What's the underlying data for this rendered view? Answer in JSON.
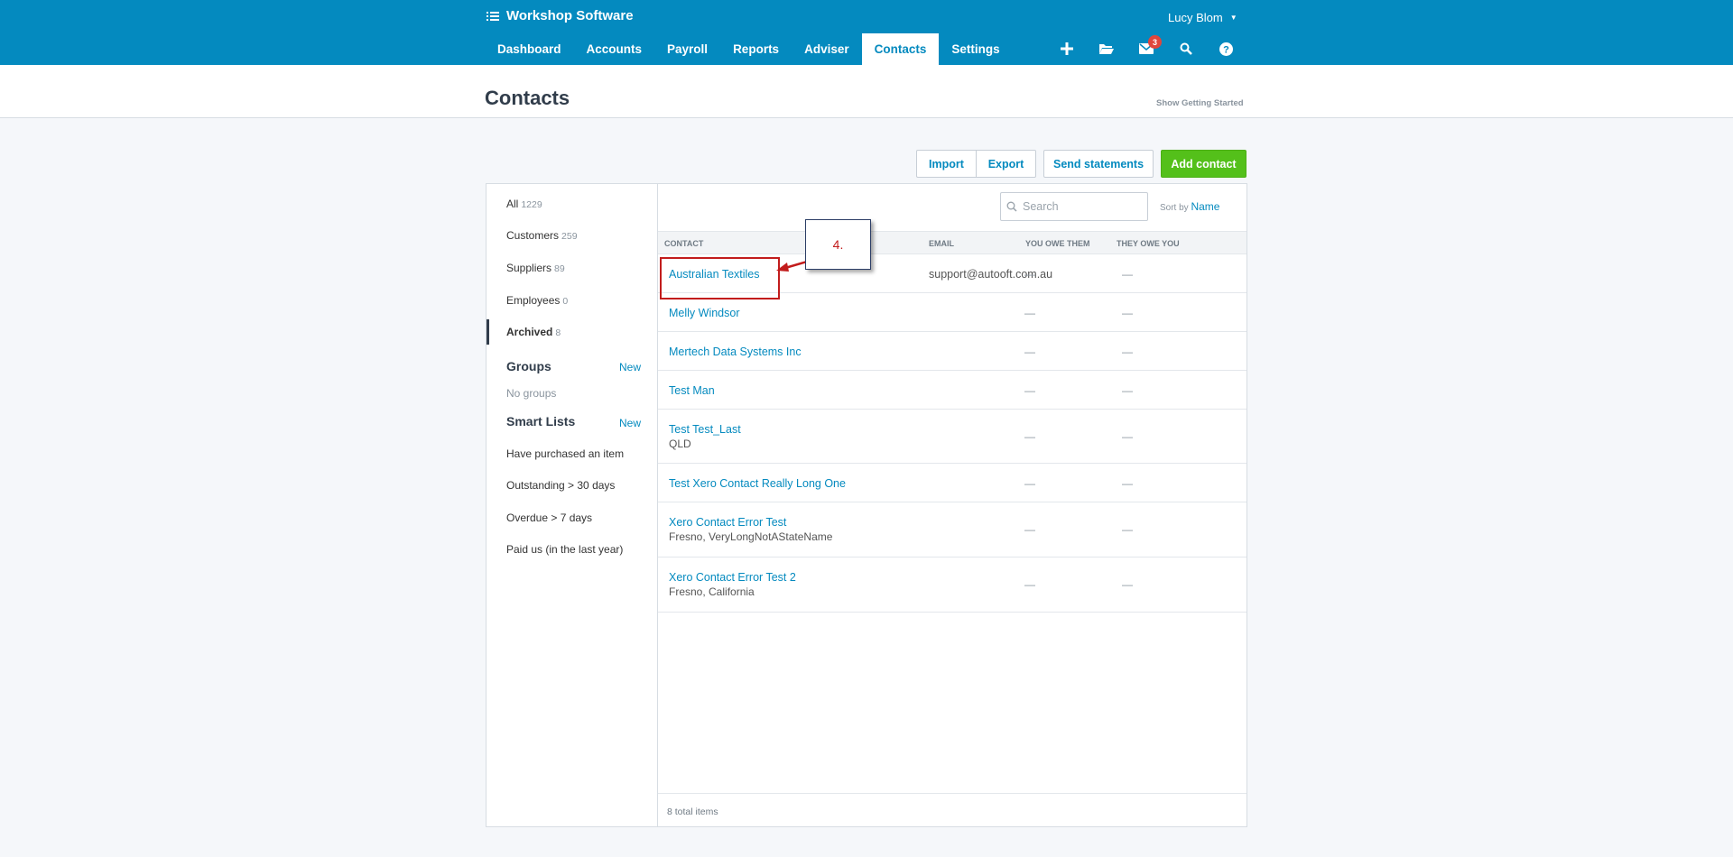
{
  "app": {
    "title": "Workshop Software",
    "user": "Lucy Blom"
  },
  "nav": {
    "items": [
      {
        "label": "Dashboard",
        "active": false
      },
      {
        "label": "Accounts",
        "active": false
      },
      {
        "label": "Payroll",
        "active": false
      },
      {
        "label": "Reports",
        "active": false
      },
      {
        "label": "Adviser",
        "active": false
      },
      {
        "label": "Contacts",
        "active": true
      },
      {
        "label": "Settings",
        "active": false
      }
    ],
    "icons": [
      "plus-icon",
      "folder-icon",
      "mail-icon",
      "search-icon",
      "help-icon"
    ],
    "mail_badge": "3"
  },
  "page": {
    "title": "Contacts",
    "getting_started": "Show Getting Started"
  },
  "actions": {
    "import": "Import",
    "export": "Export",
    "send_statements": "Send statements",
    "add_contact": "Add contact"
  },
  "sidebar": {
    "filters": [
      {
        "label": "All",
        "count": "1229"
      },
      {
        "label": "Customers",
        "count": "259"
      },
      {
        "label": "Suppliers",
        "count": "89"
      },
      {
        "label": "Employees",
        "count": "0"
      },
      {
        "label": "Archived",
        "count": "8"
      }
    ],
    "groups_heading": "Groups",
    "groups_new": "New",
    "no_groups": "No groups",
    "smart_lists_heading": "Smart Lists",
    "smart_lists_new": "New",
    "smart_lists": [
      "Have purchased an item",
      "Outstanding > 30 days",
      "Overdue > 7 days",
      "Paid us (in the last year)"
    ]
  },
  "table": {
    "search_placeholder": "Search",
    "sort_label": "Sort by",
    "sort_value": "Name",
    "columns": {
      "contact": "CONTACT",
      "email": "EMAIL",
      "you_owe": "YOU OWE THEM",
      "they_owe": "THEY OWE YOU"
    },
    "rows": [
      {
        "name": "Australian Textiles",
        "sub": "",
        "email": "support@autooft.com.au",
        "you_owe": "—",
        "they_owe": "—"
      },
      {
        "name": "Melly Windsor",
        "sub": "",
        "email": "",
        "you_owe": "—",
        "they_owe": "—"
      },
      {
        "name": "Mertech Data Systems Inc",
        "sub": "",
        "email": "",
        "you_owe": "—",
        "they_owe": "—"
      },
      {
        "name": "Test Man",
        "sub": "",
        "email": "",
        "you_owe": "—",
        "they_owe": "—"
      },
      {
        "name": "Test Test_Last",
        "sub": "QLD",
        "email": "",
        "you_owe": "—",
        "they_owe": "—"
      },
      {
        "name": "Test Xero Contact Really Long One",
        "sub": "",
        "email": "",
        "you_owe": "—",
        "they_owe": "—"
      },
      {
        "name": "Xero Contact Error Test",
        "sub": "Fresno, VeryLongNotAStateName",
        "email": "",
        "you_owe": "—",
        "they_owe": "—"
      },
      {
        "name": "Xero Contact Error Test 2",
        "sub": "Fresno, California",
        "email": "",
        "you_owe": "—",
        "they_owe": "—"
      }
    ],
    "footer": "8 total items"
  },
  "annotation": {
    "step_label": "4."
  },
  "colors": {
    "brand": "#048abf",
    "add_button": "#54c01a",
    "highlight": "#c21c1c"
  }
}
